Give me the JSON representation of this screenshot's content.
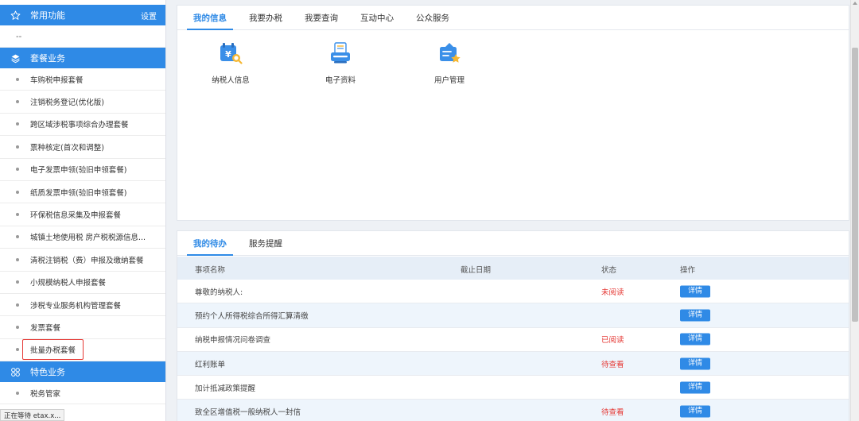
{
  "sidebar": {
    "common": {
      "title": "常用功能",
      "settings": "设置",
      "placeholder": "--"
    },
    "package": {
      "title": "套餐业务",
      "items": [
        "车购税申报套餐",
        "注销税务登记(优化版)",
        "跨区域涉税事项综合办理套餐",
        "票种核定(首次和调整)",
        "电子发票申领(验旧申领套餐)",
        "纸质发票申领(验旧申领套餐)",
        "环保税信息采集及申报套餐",
        "城镇土地使用税 房产税税源信息...",
        "清税注销税（费）申报及缴纳套餐",
        "小规模纳税人申报套餐",
        "涉税专业服务机构管理套餐",
        "发票套餐",
        "批量办税套餐"
      ]
    },
    "special": {
      "title": "特色业务",
      "items": [
        "税务管家"
      ]
    }
  },
  "status_bar": "正在等待 etax.x...",
  "info_panel": {
    "tabs": [
      "我的信息",
      "我要办税",
      "我要查询",
      "互动中心",
      "公众服务"
    ],
    "active_tab": "我的信息",
    "cards": [
      {
        "label": "纳税人信息",
        "icon": "taxpayer-info-icon"
      },
      {
        "label": "电子资料",
        "icon": "electronic-docs-icon"
      },
      {
        "label": "用户管理",
        "icon": "user-management-icon"
      }
    ]
  },
  "todo_panel": {
    "tabs": [
      "我的待办",
      "服务提醒"
    ],
    "active_tab": "我的待办",
    "columns": {
      "name": "事项名称",
      "deadline": "截止日期",
      "status": "状态",
      "action": "操作"
    },
    "rows": [
      {
        "name": "尊敬的纳税人:",
        "status": "未阅读",
        "action": "详情"
      },
      {
        "name": "预约个人所得税综合所得汇算清缴",
        "status": "",
        "action": "详情"
      },
      {
        "name": "纳税申报情况问卷调查",
        "status": "已阅读",
        "action": "详情"
      },
      {
        "name": "红利账单",
        "status": "待查看",
        "action": "详情"
      },
      {
        "name": "加计抵减政策提醒",
        "status": "",
        "action": "详情"
      },
      {
        "name": "致全区增值税一般纳税人一封信",
        "status": "待查看",
        "action": "详情"
      }
    ]
  },
  "colors": {
    "accent": "#2f8ae6",
    "status_red": "#e53935",
    "highlight_border": "#e53935"
  }
}
